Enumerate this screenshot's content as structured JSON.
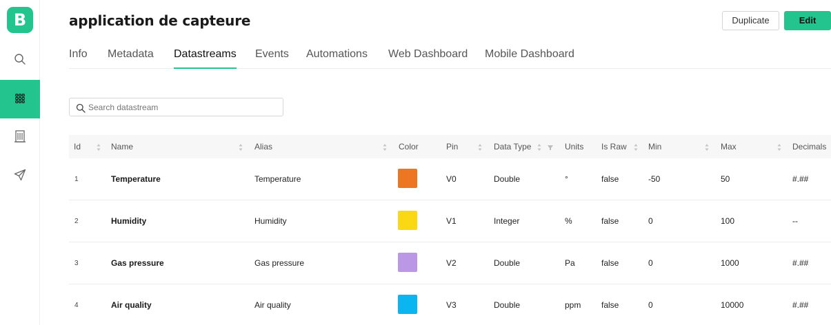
{
  "app": {
    "logo_letter": "B"
  },
  "sidebar": {
    "items": [
      {
        "icon": "search-icon"
      },
      {
        "icon": "grid-apps-icon",
        "active": true
      },
      {
        "icon": "building-icon"
      },
      {
        "icon": "send-icon"
      }
    ]
  },
  "header": {
    "title": "application de capteure",
    "duplicate_label": "Duplicate",
    "edit_label": "Edit"
  },
  "tabs": [
    {
      "label": "Info"
    },
    {
      "label": "Metadata"
    },
    {
      "label": "Datastreams",
      "active": true
    },
    {
      "label": "Events"
    },
    {
      "label": "Automations"
    },
    {
      "label": "Web Dashboard"
    },
    {
      "label": "Mobile Dashboard"
    }
  ],
  "search": {
    "placeholder": "Search datastream",
    "value": ""
  },
  "table": {
    "columns": [
      "Id",
      "Name",
      "Alias",
      "Color",
      "Pin",
      "Data Type",
      "Units",
      "Is Raw",
      "Min",
      "Max",
      "Decimals"
    ],
    "rows": [
      {
        "id": "1",
        "name": "Temperature",
        "alias": "Temperature",
        "color": "#ed7622",
        "pin": "V0",
        "data_type": "Double",
        "units": "°",
        "is_raw": "false",
        "min": "-50",
        "max": "50",
        "decimals": "#.##"
      },
      {
        "id": "2",
        "name": "Humidity",
        "alias": "Humidity",
        "color": "#fbd814",
        "pin": "V1",
        "data_type": "Integer",
        "units": "%",
        "is_raw": "false",
        "min": "0",
        "max": "100",
        "decimals": "--"
      },
      {
        "id": "3",
        "name": "Gas pressure",
        "alias": "Gas pressure",
        "color": "#bb98e6",
        "pin": "V2",
        "data_type": "Double",
        "units": "Pa",
        "is_raw": "false",
        "min": "0",
        "max": "1000",
        "decimals": "#.##"
      },
      {
        "id": "4",
        "name": "Air quality",
        "alias": "Air quality",
        "color": "#0bb6f0",
        "pin": "V3",
        "data_type": "Double",
        "units": "ppm",
        "is_raw": "false",
        "min": "0",
        "max": "10000",
        "decimals": "#.##"
      }
    ]
  },
  "colors": {
    "accent": "#23c48e"
  }
}
